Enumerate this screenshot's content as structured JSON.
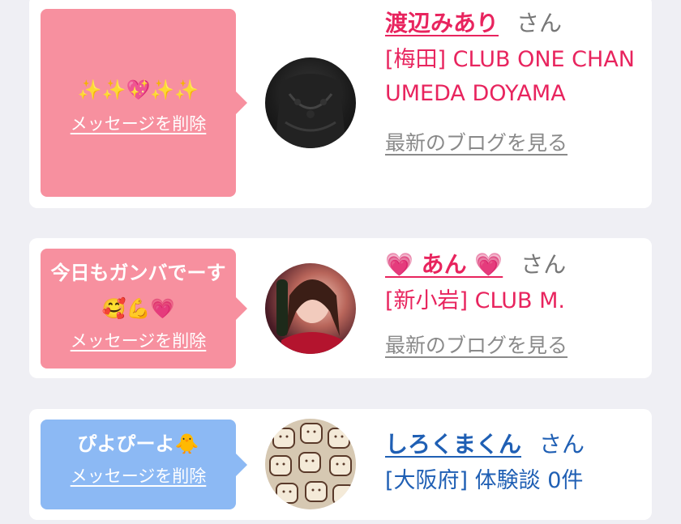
{
  "cards": [
    {
      "message": "✨✨💖✨✨",
      "delete_label": "メッセージを削除",
      "name": "渡辺みあり",
      "honorific": "さん",
      "shop": "[梅田] CLUB ONE CHAN UMEDA DOYAMA",
      "blog_link": "最新のブログを見る",
      "theme": "pink"
    },
    {
      "message": "今日もガンバでーす🥰💪💗",
      "delete_label": "メッセージを削除",
      "name": "💗 あん 💗",
      "honorific": "さん",
      "shop": "[新小岩] CLUB M.",
      "blog_link": "最新のブログを見る",
      "theme": "pink"
    },
    {
      "message": "ぴよぴーよ🐥",
      "delete_label": "メッセージを削除",
      "name": "しろくまくん",
      "honorific": "さん",
      "shop": "[大阪府] 体験談 0件",
      "theme": "blue"
    }
  ],
  "colors": {
    "pink_bubble": "#f7909f",
    "blue_bubble": "#8cb9f4",
    "pink_text": "#e8245e",
    "blue_text": "#1f5fb4",
    "background": "#efeff4"
  }
}
